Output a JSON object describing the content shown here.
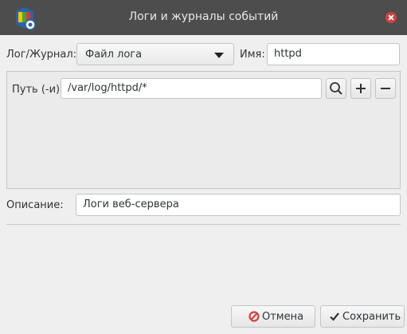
{
  "window": {
    "title": "Логи и журналы событий",
    "app_icon": "journal-app-icon",
    "close_icon": "close-icon"
  },
  "form": {
    "log_type_label": "Лог/Журнал:",
    "log_type_value": "Файл лога",
    "name_label": "Имя:",
    "name_value": "httpd",
    "path_label": "Путь (-и):",
    "path_value": "/var/log/httpd/*",
    "description_label": "Описание:",
    "description_value": "Логи веб-сервера"
  },
  "buttons": {
    "cancel": "Отмена",
    "save": "Сохранить"
  },
  "colors": {
    "titlebar": "#4d4d4d",
    "close": "#d43f3f",
    "cancel_icon": "#d43f3f",
    "background": "#efefef"
  }
}
